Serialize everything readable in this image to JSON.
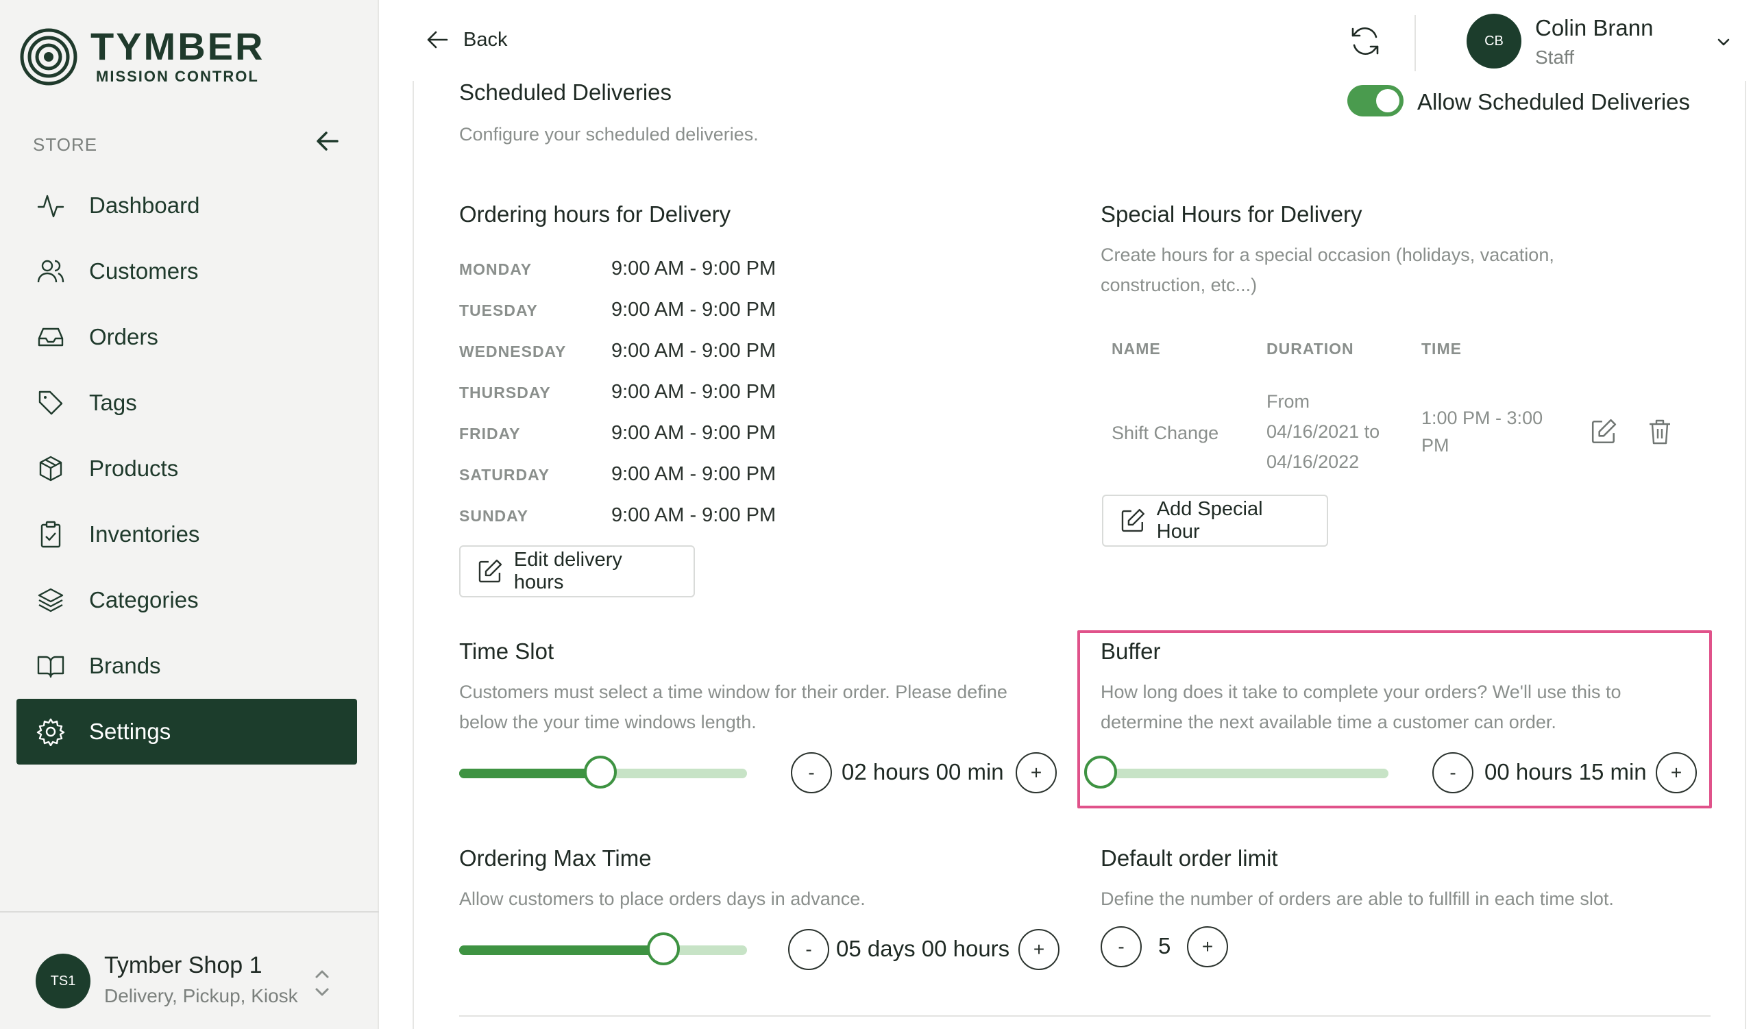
{
  "brand": {
    "title": "TYMBER",
    "subtitle": "MISSION CONTROL"
  },
  "sidebar": {
    "section_label": "STORE",
    "items": [
      {
        "label": "Dashboard",
        "icon": "activity-icon"
      },
      {
        "label": "Customers",
        "icon": "users-icon"
      },
      {
        "label": "Orders",
        "icon": "inbox-icon"
      },
      {
        "label": "Tags",
        "icon": "tag-icon"
      },
      {
        "label": "Products",
        "icon": "box-icon"
      },
      {
        "label": "Inventories",
        "icon": "clipboard-icon"
      },
      {
        "label": "Categories",
        "icon": "layers-icon"
      },
      {
        "label": "Brands",
        "icon": "book-icon"
      },
      {
        "label": "Settings",
        "icon": "gear-icon",
        "active": true
      }
    ],
    "shop": {
      "initials": "TS1",
      "name": "Tymber Shop 1",
      "modes": "Delivery, Pickup, Kiosk"
    }
  },
  "topbar": {
    "back_label": "Back",
    "user": {
      "initials": "CB",
      "name": "Colin Brann",
      "role": "Staff"
    }
  },
  "scheduled": {
    "title": "Scheduled Deliveries",
    "description": "Configure your scheduled deliveries.",
    "toggle_label": "Allow Scheduled Deliveries",
    "toggle_on": true
  },
  "ordering_hours": {
    "title": "Ordering hours for Delivery",
    "days": [
      {
        "day": "MONDAY",
        "hours": "9:00 AM - 9:00 PM"
      },
      {
        "day": "TUESDAY",
        "hours": "9:00 AM - 9:00 PM"
      },
      {
        "day": "WEDNESDAY",
        "hours": "9:00 AM - 9:00 PM"
      },
      {
        "day": "THURSDAY",
        "hours": "9:00 AM - 9:00 PM"
      },
      {
        "day": "FRIDAY",
        "hours": "9:00 AM - 9:00 PM"
      },
      {
        "day": "SATURDAY",
        "hours": "9:00 AM - 9:00 PM"
      },
      {
        "day": "SUNDAY",
        "hours": "9:00 AM - 9:00 PM"
      }
    ],
    "edit_button": "Edit delivery hours"
  },
  "special_hours": {
    "title": "Special Hours for Delivery",
    "description_line1": "Create hours for a special occasion (holidays, vacation,",
    "description_line2": "construction, etc...)",
    "columns": [
      "NAME",
      "DURATION",
      "TIME"
    ],
    "rows": [
      {
        "name": "Shift Change",
        "duration_line1": "From",
        "duration_line2": "04/16/2021 to",
        "duration_line3": "04/16/2022",
        "time_line1": "1:00 PM - 3:00",
        "time_line2": "PM"
      }
    ],
    "add_button": "Add Special Hour"
  },
  "time_slot": {
    "title": "Time Slot",
    "description_line1": "Customers must select a time window for their order. Please define",
    "description_line2": "below the your time windows length.",
    "value": "02 hours 00 min",
    "slider_fraction": 0.49,
    "minus": "-",
    "plus": "+"
  },
  "buffer": {
    "title": "Buffer",
    "description_line1": "How long does it take to complete your orders? We'll use this to",
    "description_line2": "determine the next available time a customer can order.",
    "value": "00 hours 15 min",
    "slider_fraction": 0.0,
    "minus": "-",
    "plus": "+",
    "highlight_color": "#e0528a"
  },
  "max_time": {
    "title": "Ordering Max Time",
    "description": "Allow customers to place orders days in advance.",
    "value": "05 days 00 hours",
    "slider_fraction": 0.71,
    "minus": "-",
    "plus": "+"
  },
  "order_limit": {
    "title": "Default order limit",
    "description": "Define the number of orders are able to fullfill in each time slot.",
    "value": "5",
    "minus": "-",
    "plus": "+"
  },
  "colors": {
    "brand_dark": "#1c3d2c",
    "accent_green": "#3e9342",
    "track_light": "#c7e3c6"
  }
}
